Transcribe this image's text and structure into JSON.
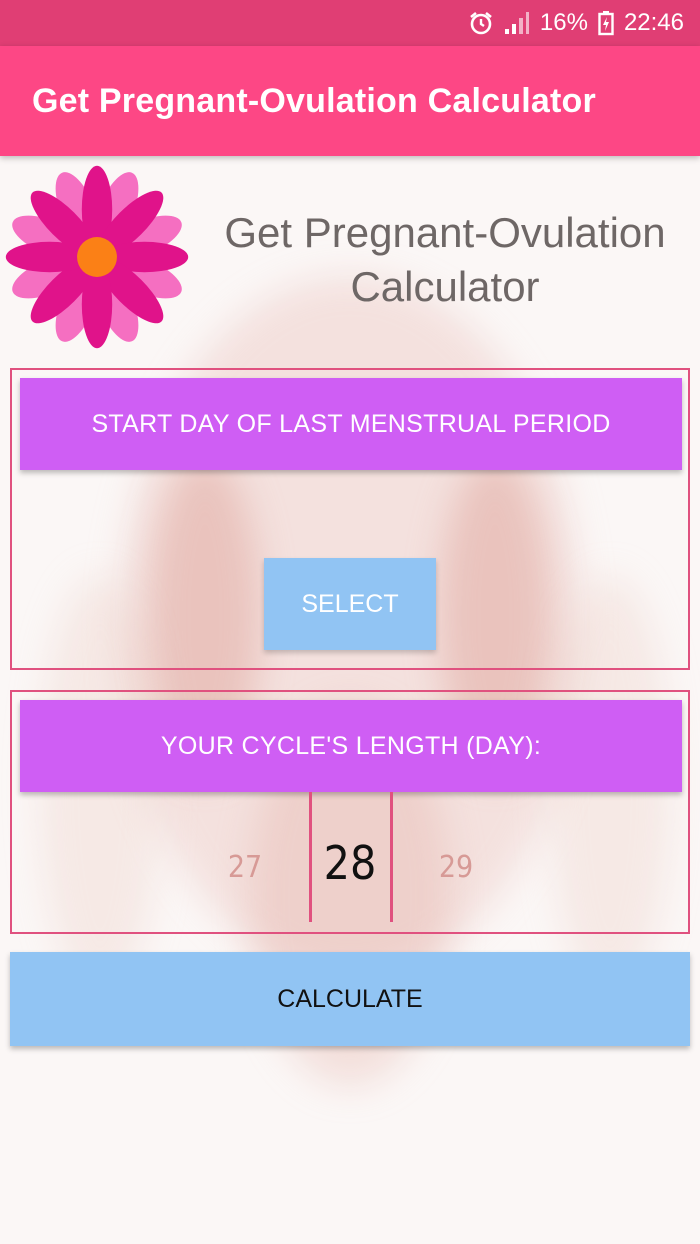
{
  "status_bar": {
    "battery": "16%",
    "time": "22:46",
    "icons": [
      "alarm-icon",
      "signal-icon",
      "battery-icon"
    ]
  },
  "app_bar": {
    "title": "Get Pregnant-Ovulation Calculator",
    "color": "#fd4785"
  },
  "header": {
    "logo": "flower-icon",
    "title_line1": "Get Pregnant-Ovulation",
    "title_line2": "Calculator"
  },
  "period_section": {
    "heading": "START DAY OF LAST MENSTRUAL PERIOD",
    "select_label": "SELECT"
  },
  "cycle_section": {
    "heading": "YOUR CYCLE'S LENGTH (DAY):",
    "picker": {
      "prev": "27",
      "current": "28",
      "next": "29"
    }
  },
  "actions": {
    "calculate_label": "CALCULATE"
  },
  "colors": {
    "accent_purple": "#cf5ef4",
    "button_blue": "#91c4f3",
    "border_pink": "#e0517f"
  }
}
